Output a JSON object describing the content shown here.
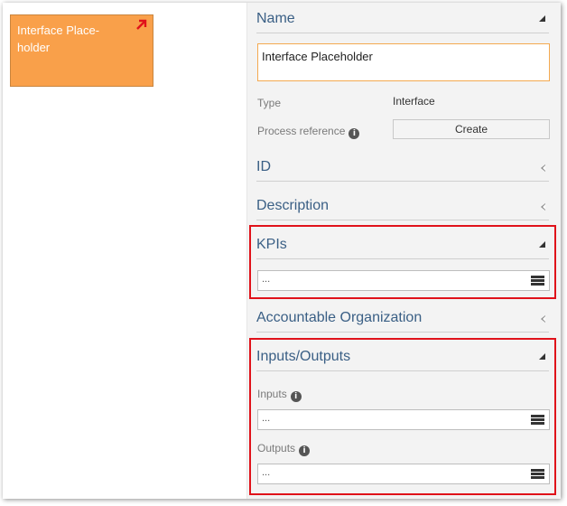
{
  "canvas": {
    "shape": {
      "label": "Interface Place-holder",
      "fill": "#f9a04a",
      "arrow_color": "#e0121a"
    }
  },
  "panel": {
    "name": {
      "title": "Name",
      "value": "Interface Placeholder"
    },
    "type": {
      "label": "Type",
      "value": "Interface"
    },
    "process_reference": {
      "label": "Process reference",
      "button": "Create"
    },
    "id": {
      "title": "ID"
    },
    "description": {
      "title": "Description"
    },
    "kpis": {
      "title": "KPIs",
      "value": "..."
    },
    "accountable_org": {
      "title": "Accountable Organization"
    },
    "inputs_outputs": {
      "title": "Inputs/Outputs",
      "inputs_label": "Inputs",
      "inputs_value": "...",
      "outputs_label": "Outputs",
      "outputs_value": "..."
    }
  },
  "icons": {
    "info": "info-icon",
    "menu": "hamburger-menu-icon"
  },
  "colors": {
    "accent": "#3a5f85",
    "highlight": "#e0121a",
    "input_focus": "#f4a950"
  }
}
